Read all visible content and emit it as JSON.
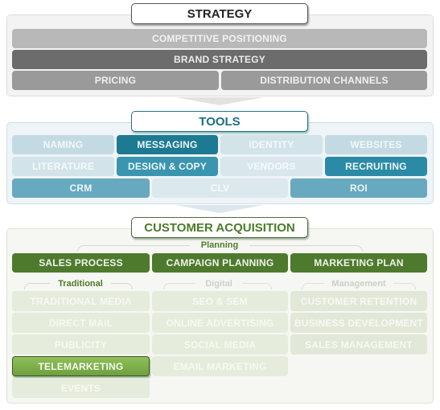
{
  "strategy": {
    "title": "STRATEGY",
    "items": {
      "competitive_positioning": "COMPETITIVE POSITIONING",
      "brand_strategy": "BRAND STRATEGY",
      "pricing": "PRICING",
      "distribution_channels": "DISTRIBUTION CHANNELS"
    }
  },
  "tools": {
    "title": "TOOLS",
    "row1": [
      "NAMING",
      "MESSAGING",
      "IDENTITY",
      "WEBSITES"
    ],
    "row2": [
      "LITERATURE",
      "DESIGN & COPY",
      "VENDORS",
      "RECRUITING"
    ],
    "row3": [
      "CRM",
      "CLV",
      "ROI"
    ]
  },
  "customer_acquisition": {
    "title": "CUSTOMER ACQUISITION",
    "planning_label": "Planning",
    "planning": [
      "SALES PROCESS",
      "CAMPAIGN PLANNING",
      "MARKETING PLAN"
    ],
    "traditional": {
      "label": "Traditional",
      "items": [
        "TRADITIONAL MEDIA",
        "DIRECT MAIL",
        "PUBLICITY",
        "TELEMARKETING",
        "EVENTS"
      ]
    },
    "digital": {
      "label": "Digital",
      "items": [
        "SEO & SEM",
        "ONLINE ADVERTISING",
        "SOCIAL MEDIA",
        "EMAIL MARKETING"
      ]
    },
    "management": {
      "label": "Management",
      "items": [
        "CUSTOMER RETENTION",
        "BUSINESS DEVELOPMENT",
        "SALES MANAGEMENT"
      ]
    }
  },
  "colors": {
    "strategy_dark": "#6b6b6b",
    "strategy_light": "#b9b9b9",
    "tools_dark": "#1e7f98",
    "tools_mid": "#3b97b0",
    "tools_light": "#c5dbe4",
    "acq_dark": "#4e7a2e",
    "acq_highlight": "#7fb04a",
    "acq_faded": "#e4ecd8"
  }
}
